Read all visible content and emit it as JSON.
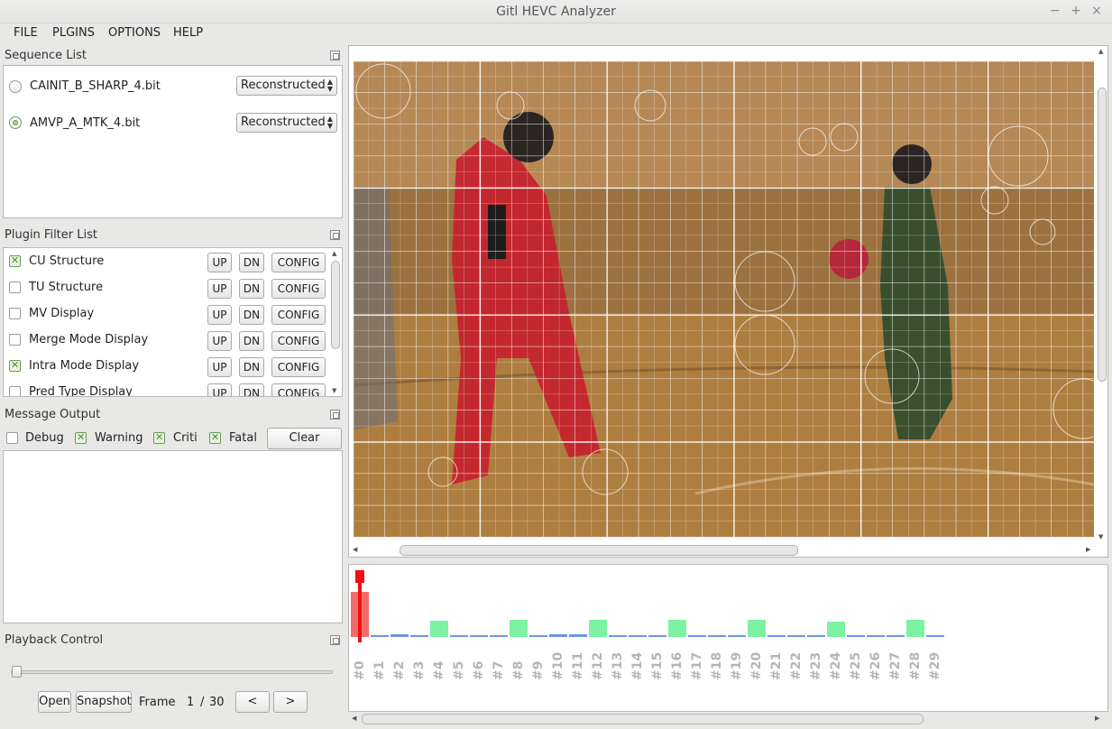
{
  "window": {
    "title": "Gitl HEVC Analyzer",
    "controls": [
      "−",
      "+",
      "×"
    ]
  },
  "menu": [
    "FILE",
    "PLGINS",
    "OPTIONS",
    "HELP"
  ],
  "sequence_list": {
    "title": "Sequence List",
    "items": [
      {
        "name": "CAINIT_B_SHARP_4.bit",
        "mode": "Reconstructed",
        "selected": false
      },
      {
        "name": "AMVP_A_MTK_4.bit",
        "mode": "Reconstructed",
        "selected": true
      }
    ]
  },
  "plugin_filter": {
    "title": "Plugin Filter List",
    "up_label": "UP",
    "dn_label": "DN",
    "config_label": "CONFIG",
    "items": [
      {
        "name": "CU Structure",
        "checked": true
      },
      {
        "name": "TU Structure",
        "checked": false
      },
      {
        "name": "MV Display",
        "checked": false
      },
      {
        "name": "Merge Mode Display",
        "checked": false
      },
      {
        "name": "Intra Mode Display",
        "checked": true
      },
      {
        "name": "Pred Type Display",
        "checked": false
      }
    ]
  },
  "message_output": {
    "title": "Message Output",
    "filters": [
      {
        "label": "Debug",
        "checked": false
      },
      {
        "label": "Warning",
        "checked": true
      },
      {
        "label": "Criti",
        "checked": true
      },
      {
        "label": "Fatal",
        "checked": true
      }
    ],
    "clear_label": "Clear"
  },
  "playback": {
    "title": "Playback Control",
    "open_label": "Open",
    "snapshot_label": "Snapshot",
    "frame_label": "Frame",
    "current_frame": "1",
    "separator": "/",
    "total_frames": "30",
    "prev_label": "<",
    "next_label": ">"
  },
  "timeline": {
    "frames": [
      "#0",
      "#1",
      "#2",
      "#3",
      "#4",
      "#5",
      "#6",
      "#7",
      "#8",
      "#9",
      "#10",
      "#11",
      "#12",
      "#13",
      "#14",
      "#15",
      "#16",
      "#17",
      "#18",
      "#19",
      "#20",
      "#21",
      "#22",
      "#23",
      "#24",
      "#25",
      "#26",
      "#27",
      "#28",
      "#29"
    ],
    "bitrates": [
      50,
      2,
      3,
      2,
      18,
      1,
      2,
      2,
      19,
      2,
      3,
      3,
      19,
      1,
      2,
      1,
      19,
      2,
      2,
      2,
      19,
      1,
      2,
      1,
      17,
      1,
      2,
      1,
      19,
      1
    ],
    "types": [
      "I",
      "P",
      "P",
      "P",
      "B",
      "P",
      "P",
      "P",
      "B",
      "P",
      "P",
      "P",
      "B",
      "P",
      "P",
      "P",
      "B",
      "P",
      "P",
      "P",
      "B",
      "P",
      "P",
      "P",
      "B",
      "P",
      "P",
      "P",
      "B",
      "P"
    ],
    "colors": {
      "I": "#f26b6b",
      "P": "#6e95e8",
      "B": "#7df2a2",
      "cursor": "#ee1111"
    }
  }
}
